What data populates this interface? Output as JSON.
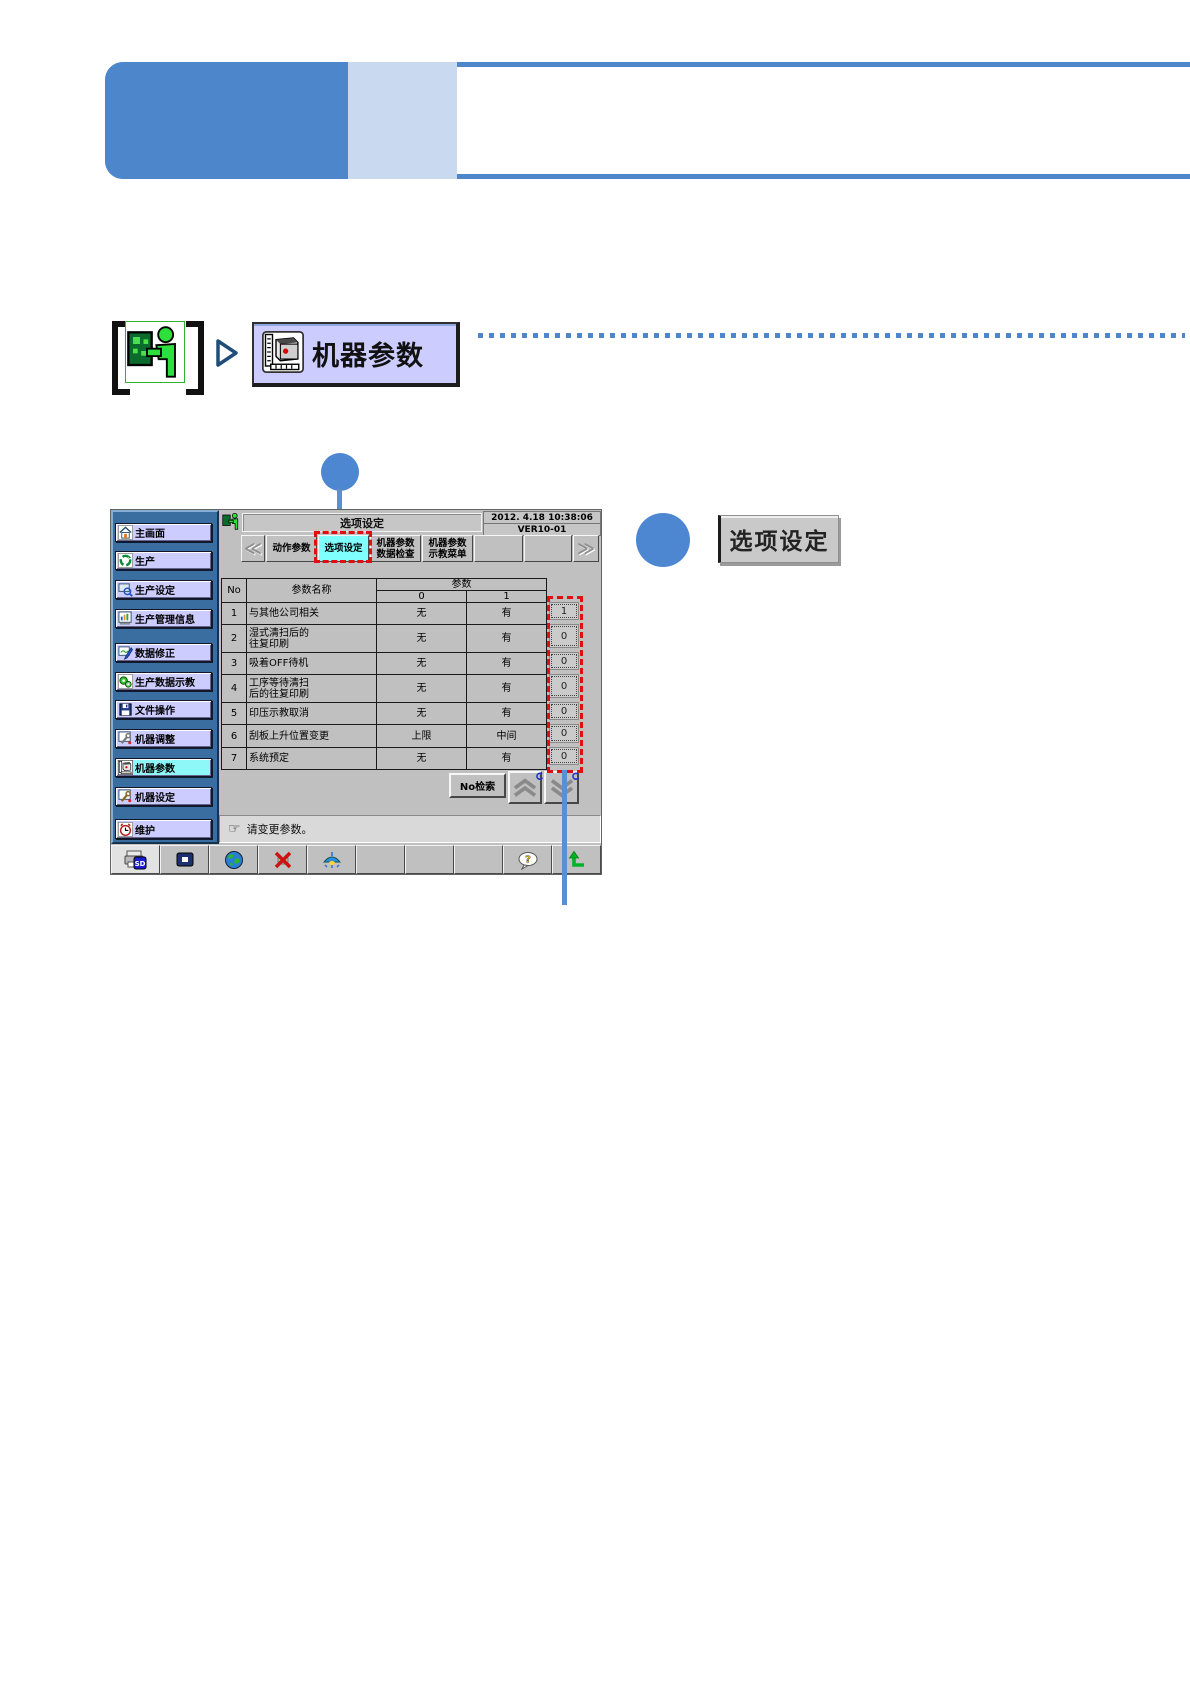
{
  "banner": {
    "dark_color": "#4d86cb",
    "light_color": "#c8d9f0"
  },
  "step_nav": {
    "operator_icon": "operator-panel-icon",
    "arrow_icon": "triangle-right-icon",
    "menu_button_label": "机器参数",
    "menu_button_icon": "machine-parameter-icon"
  },
  "callouts": {
    "one_label": "",
    "two_label": "",
    "highlight_color": "#e01010",
    "circle_color": "#4e87d1"
  },
  "action_button": {
    "label": "选项设定"
  },
  "screen": {
    "title": "选项设定",
    "datetime": "2012. 4.18 10:38:06",
    "version": "VER10-01",
    "sidebar_items": [
      {
        "label": "主画面",
        "icon": "home-icon",
        "active": false
      },
      {
        "label": "生产",
        "icon": "production-icon",
        "active": false
      },
      {
        "label": "生产设定",
        "icon": "production-settings-icon",
        "active": false
      },
      {
        "label": "生产管理信息",
        "icon": "production-info-icon",
        "active": false
      },
      {
        "label": "数据修正",
        "icon": "data-correction-icon",
        "active": false
      },
      {
        "label": "生产数据示教",
        "icon": "teaching-icon",
        "active": false
      },
      {
        "label": "文件操作",
        "icon": "file-operation-icon",
        "active": false
      },
      {
        "label": "机器调整",
        "icon": "machine-adjust-icon",
        "active": false
      },
      {
        "label": "机器参数",
        "icon": "machine-parameter-icon",
        "active": true
      },
      {
        "label": "机器设定",
        "icon": "machine-settings-icon",
        "active": false
      },
      {
        "label": "维护",
        "icon": "maintenance-icon",
        "active": false
      }
    ],
    "tab_prev": "≪",
    "tab_next": "≫",
    "tabs": [
      {
        "label": "动作参数",
        "active": false
      },
      {
        "label": "选项设定",
        "active": true
      },
      {
        "label": "机器参数\n数据检查",
        "active": false
      },
      {
        "label": "机器参数\n示教菜单",
        "active": false
      }
    ],
    "table": {
      "headers": {
        "no": "No",
        "name": "参数名称",
        "param": "参数",
        "sub0": "0",
        "sub1": "1"
      },
      "rows": [
        {
          "no": "1",
          "name": "与其他公司相关",
          "opt0": "无",
          "opt1": "有",
          "value": "1"
        },
        {
          "no": "2",
          "name": "湿式清扫后的\n往复印刷",
          "opt0": "无",
          "opt1": "有",
          "value": "0"
        },
        {
          "no": "3",
          "name": "吸着OFF待机",
          "opt0": "无",
          "opt1": "有",
          "value": "0"
        },
        {
          "no": "4",
          "name": "工序等待清扫\n后的往复印刷",
          "opt0": "无",
          "opt1": "有",
          "value": "0"
        },
        {
          "no": "5",
          "name": "印压示教取消",
          "opt0": "无",
          "opt1": "有",
          "value": "0"
        },
        {
          "no": "6",
          "name": "刮板上升位置变更",
          "opt0": "上限",
          "opt1": "中间",
          "value": "0"
        },
        {
          "no": "7",
          "name": "系统预定",
          "opt0": "无",
          "opt1": "有",
          "value": "0"
        }
      ]
    },
    "search_button_label": "No检索",
    "scroll_up_icon": "double-chevron-up-icon",
    "scroll_down_icon": "double-chevron-down-icon",
    "status_hand_icon": "pointing-hand-icon",
    "status_message": "请变更参数。",
    "toolbar_icons": [
      "sd-print-icon",
      "monitor-icon",
      "globe-icon",
      "network-off-icon",
      "lamp-icon",
      "",
      "",
      "",
      "help-icon",
      "exit-icon"
    ]
  }
}
